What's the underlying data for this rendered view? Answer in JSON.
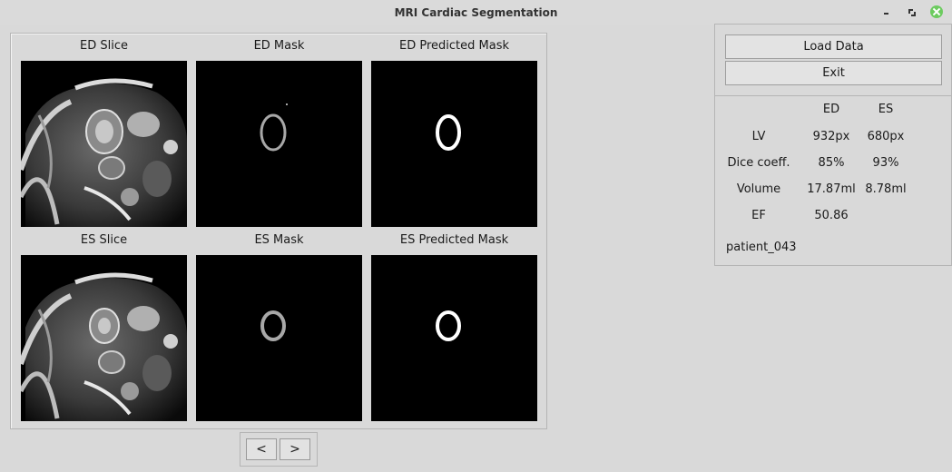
{
  "window": {
    "title": "MRI Cardiac Segmentation"
  },
  "images": {
    "ed_slice_label": "ED Slice",
    "ed_mask_label": "ED Mask",
    "ed_pred_label": "ED Predicted Mask",
    "es_slice_label": "ES Slice",
    "es_mask_label": "ES Mask",
    "es_pred_label": "ES Predicted Mask"
  },
  "nav": {
    "prev_label": "<",
    "next_label": ">"
  },
  "actions": {
    "load_label": "Load Data",
    "exit_label": "Exit"
  },
  "stats": {
    "col_ed": "ED",
    "col_es": "ES",
    "rows": [
      {
        "label": "LV",
        "ed": "932px",
        "es": "680px"
      },
      {
        "label": "Dice coeff.",
        "ed": "85%",
        "es": "93%"
      },
      {
        "label": "Volume",
        "ed": "17.87ml",
        "es": "8.78ml"
      },
      {
        "label": "EF",
        "ed": "50.86",
        "es": ""
      }
    ],
    "patient": "patient_043"
  },
  "colors": {
    "window_bg": "#d9d9d9",
    "mask_gray": "#a8a8a8",
    "pred_white": "#ffffff",
    "close_button": "#6ccb5f"
  },
  "icons": [
    "minimize-icon",
    "maximize-icon",
    "close-icon"
  ]
}
